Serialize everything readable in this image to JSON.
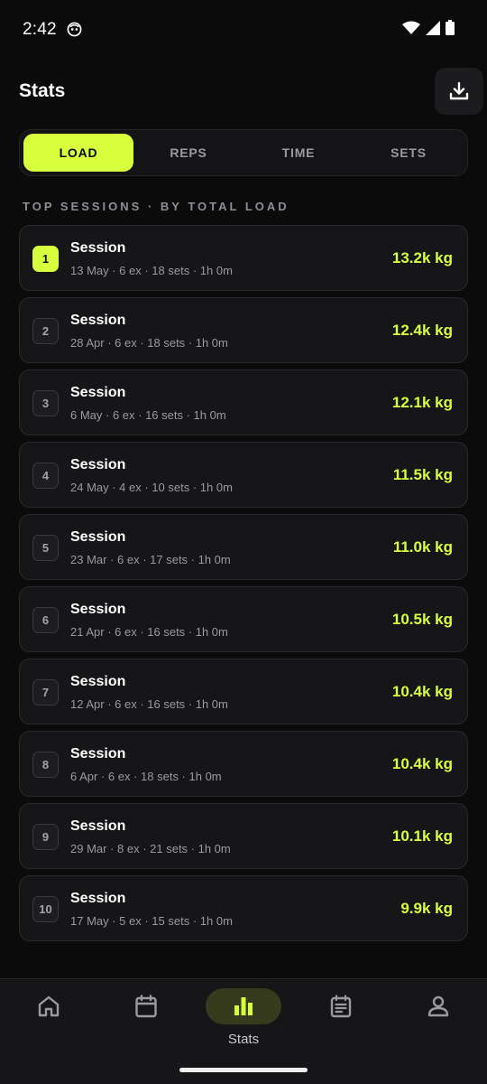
{
  "status_bar": {
    "time": "2:42"
  },
  "header": {
    "title": "Stats"
  },
  "tabs": [
    {
      "label": "LOAD",
      "active": true
    },
    {
      "label": "REPS",
      "active": false
    },
    {
      "label": "TIME",
      "active": false
    },
    {
      "label": "SETS",
      "active": false
    }
  ],
  "section": {
    "label": "TOP SESSIONS · BY TOTAL LOAD"
  },
  "sessions": [
    {
      "rank": "1",
      "name": "Session",
      "meta": "13 May · 6 ex · 18 sets · 1h 0m",
      "load": "13.2k kg"
    },
    {
      "rank": "2",
      "name": "Session",
      "meta": "28 Apr · 6 ex · 18 sets · 1h 0m",
      "load": "12.4k kg"
    },
    {
      "rank": "3",
      "name": "Session",
      "meta": "6 May · 6 ex · 16 sets · 1h 0m",
      "load": "12.1k kg"
    },
    {
      "rank": "4",
      "name": "Session",
      "meta": "24 May · 4 ex · 10 sets · 1h 0m",
      "load": "11.5k kg"
    },
    {
      "rank": "5",
      "name": "Session",
      "meta": "23 Mar · 6 ex · 17 sets · 1h 0m",
      "load": "11.0k kg"
    },
    {
      "rank": "6",
      "name": "Session",
      "meta": "21 Apr · 6 ex · 16 sets · 1h 0m",
      "load": "10.5k kg"
    },
    {
      "rank": "7",
      "name": "Session",
      "meta": "12 Apr · 6 ex · 16 sets · 1h 0m",
      "load": "10.4k kg"
    },
    {
      "rank": "8",
      "name": "Session",
      "meta": "6 Apr · 6 ex · 18 sets · 1h 0m",
      "load": "10.4k kg"
    },
    {
      "rank": "9",
      "name": "Session",
      "meta": "29 Mar · 8 ex · 21 sets · 1h 0m",
      "load": "10.1k kg"
    },
    {
      "rank": "10",
      "name": "Session",
      "meta": "17 May · 5 ex · 15 sets · 1h 0m",
      "load": "9.9k kg"
    }
  ],
  "bottom_nav": {
    "items": [
      {
        "icon": "home-icon",
        "label": ""
      },
      {
        "icon": "calendar-icon",
        "label": ""
      },
      {
        "icon": "bar-chart-icon",
        "label": "Stats"
      },
      {
        "icon": "clipboard-icon",
        "label": ""
      },
      {
        "icon": "person-icon",
        "label": ""
      }
    ]
  },
  "colors": {
    "accent": "#d8ff3e",
    "background": "#0b0b0c",
    "card": "#161618"
  }
}
